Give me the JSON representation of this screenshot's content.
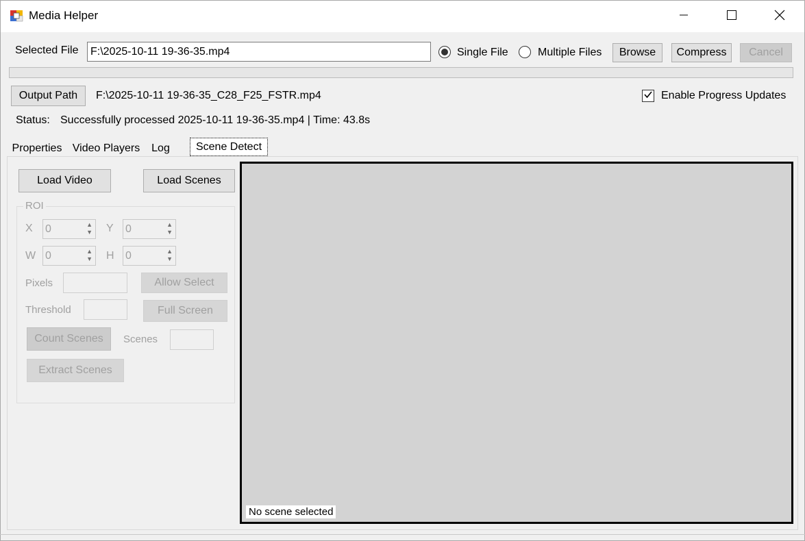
{
  "window": {
    "title": "Media Helper",
    "minimize_icon": "minimize-icon",
    "maximize_icon": "maximize-icon",
    "close_icon": "close-icon"
  },
  "file_bar": {
    "selected_file_label": "Selected File",
    "selected_file_value": "F:\\2025-10-11 19-36-35.mp4",
    "mode_single_label": "Single File",
    "mode_multiple_label": "Multiple Files",
    "mode_selected": "Single File",
    "browse_label": "Browse",
    "compress_label": "Compress",
    "cancel_label": "Cancel"
  },
  "progress": {
    "value": 0
  },
  "output": {
    "button_label": "Output Path",
    "path_value": "F:\\2025-10-11 19-36-35_C28_F25_FSTR.mp4",
    "enable_progress_label": "Enable Progress Updates",
    "enable_progress_checked": true
  },
  "status": {
    "label": "Status:",
    "text": "Successfully processed 2025-10-11 19-36-35.mp4 | Time: 43.8s"
  },
  "tabs": [
    {
      "label": "Properties",
      "active": false
    },
    {
      "label": "Video Players",
      "active": false
    },
    {
      "label": "Log",
      "active": false
    },
    {
      "label": "Scene Detect",
      "active": true
    }
  ],
  "scene_detect": {
    "load_video_label": "Load Video",
    "load_scenes_label": "Load Scenes",
    "roi": {
      "title": "ROI",
      "x_label": "X",
      "x_value": "0",
      "y_label": "Y",
      "y_value": "0",
      "w_label": "W",
      "w_value": "0",
      "h_label": "H",
      "h_value": "0"
    },
    "pixels_label": "Pixels",
    "allow_select_label": "Allow Select",
    "threshold_label": "Threshold",
    "full_screen_label": "Full Screen",
    "count_scenes_label": "Count Scenes",
    "scenes_label": "Scenes",
    "extract_scenes_label": "Extract Scenes",
    "preview_label": "No scene selected"
  }
}
